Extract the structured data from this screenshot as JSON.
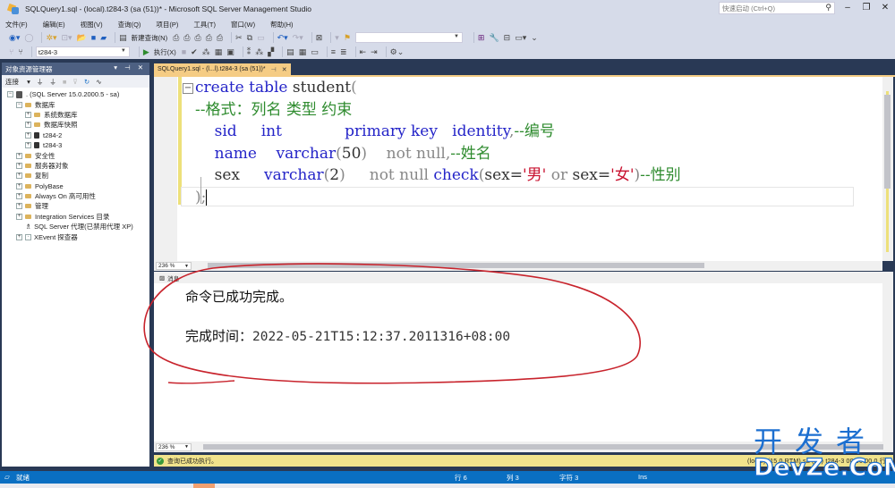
{
  "window": {
    "title": "SQLQuery1.sql - (local).t284-3 (sa (51))* - Microsoft SQL Server Management Studio",
    "quick_launch_placeholder": "快速启动 (Ctrl+Q)"
  },
  "menu": [
    "文件(F)",
    "编辑(E)",
    "视图(V)",
    "查询(Q)",
    "项目(P)",
    "工具(T)",
    "窗口(W)",
    "帮助(H)"
  ],
  "toolbar": {
    "new_query": "新建查询(N)",
    "database_combo": "t284-3",
    "execute": "执行(X)"
  },
  "object_explorer": {
    "title": "对象资源管理器",
    "connect": "连接",
    "tree": [
      {
        "label": ". (SQL Server 15.0.2000.5 - sa)",
        "level": 0,
        "expander": "−",
        "icon": "server"
      },
      {
        "label": "数据库",
        "level": 1,
        "expander": "−",
        "icon": "folder"
      },
      {
        "label": "系统数据库",
        "level": 2,
        "expander": "+",
        "icon": "folder"
      },
      {
        "label": "数据库快照",
        "level": 2,
        "expander": "+",
        "icon": "folder"
      },
      {
        "label": "t284-2",
        "level": 2,
        "expander": "+",
        "icon": "database"
      },
      {
        "label": "t284-3",
        "level": 2,
        "expander": "+",
        "icon": "database"
      },
      {
        "label": "安全性",
        "level": 1,
        "expander": "+",
        "icon": "folder"
      },
      {
        "label": "服务器对象",
        "level": 1,
        "expander": "+",
        "icon": "folder"
      },
      {
        "label": "复制",
        "level": 1,
        "expander": "+",
        "icon": "folder"
      },
      {
        "label": "PolyBase",
        "level": 1,
        "expander": "+",
        "icon": "folder"
      },
      {
        "label": "Always On 高可用性",
        "level": 1,
        "expander": "+",
        "icon": "folder"
      },
      {
        "label": "管理",
        "level": 1,
        "expander": "+",
        "icon": "folder"
      },
      {
        "label": "Integration Services 目录",
        "level": 1,
        "expander": "+",
        "icon": "folder"
      },
      {
        "label": "SQL Server 代理(已禁用代理 XP)",
        "level": 1,
        "expander": "",
        "icon": "agent"
      },
      {
        "label": "XEvent 探查器",
        "level": 1,
        "expander": "+",
        "icon": "xevent"
      }
    ]
  },
  "editor": {
    "tab_label": "SQLQuery1.sql - (l...l).t284-3 (sa (51))*",
    "zoom": "236 %",
    "lines": [
      [
        {
          "t": "create table ",
          "c": "kw"
        },
        {
          "t": "student",
          "c": "bk"
        },
        {
          "t": "(",
          "c": "gr"
        }
      ],
      [
        {
          "t": "--格式：列名 类型 约束",
          "c": "cm"
        }
      ],
      [
        {
          "t": "    sid     ",
          "c": "kw"
        },
        {
          "t": "int             ",
          "c": "kw"
        },
        {
          "t": "primary key   identity",
          "c": "kw"
        },
        {
          "t": ",",
          "c": "gr"
        },
        {
          "t": "--编号",
          "c": "cm"
        }
      ],
      [
        {
          "t": "    name    ",
          "c": "kw"
        },
        {
          "t": "varchar",
          "c": "kw"
        },
        {
          "t": "(",
          "c": "gr"
        },
        {
          "t": "50",
          "c": "bk"
        },
        {
          "t": ")    ",
          "c": "gr"
        },
        {
          "t": "not null,",
          "c": "gr"
        },
        {
          "t": "--姓名",
          "c": "cm"
        }
      ],
      [
        {
          "t": "    sex     ",
          "c": "bk"
        },
        {
          "t": "varchar",
          "c": "kw"
        },
        {
          "t": "(",
          "c": "gr"
        },
        {
          "t": "2",
          "c": "bk"
        },
        {
          "t": ")     ",
          "c": "gr"
        },
        {
          "t": "not null ",
          "c": "gr"
        },
        {
          "t": "check",
          "c": "kw"
        },
        {
          "t": "(",
          "c": "gr"
        },
        {
          "t": "sex=",
          "c": "bk"
        },
        {
          "t": "'男'",
          "c": "st"
        },
        {
          "t": " or ",
          "c": "gr"
        },
        {
          "t": "sex=",
          "c": "bk"
        },
        {
          "t": "'女'",
          "c": "st"
        },
        {
          "t": ")",
          "c": "gr"
        },
        {
          "t": "--性别",
          "c": "cm"
        }
      ],
      [
        {
          "t": ");",
          "c": "gr"
        }
      ]
    ]
  },
  "results": {
    "tab_label": "消息",
    "zoom": "236 %",
    "message": "命令已成功完成。",
    "completion_label": "完成时间：",
    "completion_time": "2022-05-21T15:12:37.2011316+08:00"
  },
  "query_status": {
    "message": "查询已成功执行。",
    "right": "(local) (15.0 RTM)   sa (51)   t284-3   00:00:00   0 行"
  },
  "statusbar": {
    "ready": "就绪",
    "row": "行 6",
    "col": "列 3",
    "char": "字符 3",
    "mode": "Ins"
  },
  "watermark": {
    "line1": "开发者",
    "line2": "DevZe.CoM"
  }
}
